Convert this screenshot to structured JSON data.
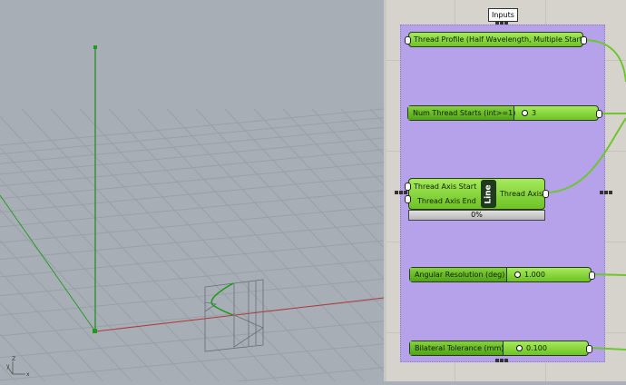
{
  "viewport": {
    "axis_labels": {
      "z": "Z",
      "y": "y",
      "x": "x"
    },
    "colors": {
      "x_axis": "#b03a3a",
      "y_axis": "#2a9a2a",
      "curve": "#1e9a1e"
    }
  },
  "group": {
    "label": "Inputs",
    "color": "#b6a2ea"
  },
  "components": {
    "thread_profile": {
      "label": "Thread Profile (Half Wavelength, Multiple Start)"
    },
    "num_starts": {
      "label": "Num Thread Starts (int>=1)",
      "value": "3"
    },
    "line": {
      "inputs": [
        "Thread Axis Start",
        "Thread Axis End"
      ],
      "name": "Line",
      "output": "Thread Axis",
      "progress": "0%"
    },
    "angular": {
      "label": "Angular Resolution (deg)",
      "value": "1.000"
    },
    "tolerance": {
      "label": "Bilateral Tolerance (mm)",
      "value": "0.100"
    }
  }
}
